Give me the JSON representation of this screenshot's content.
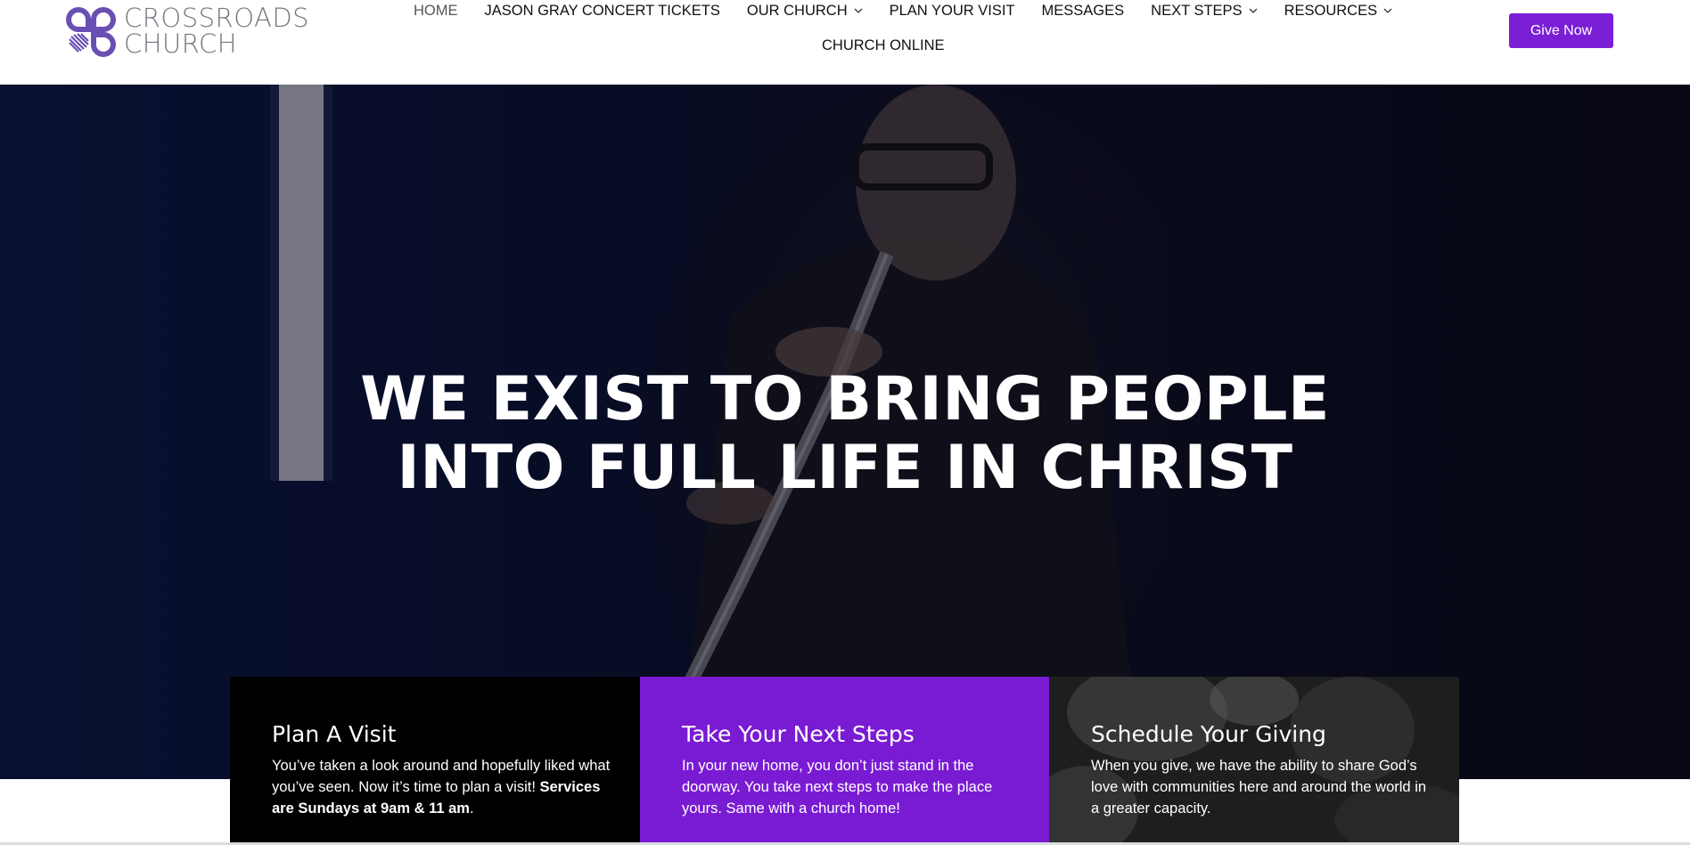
{
  "header": {
    "logo": {
      "line1": "CROSSROADS",
      "line2": "CHURCH"
    },
    "nav": [
      {
        "label": "HOME",
        "dropdown": false
      },
      {
        "label": "JASON GRAY CONCERT TICKETS",
        "dropdown": false
      },
      {
        "label": "OUR CHURCH",
        "dropdown": true
      },
      {
        "label": "PLAN YOUR VISIT",
        "dropdown": false
      },
      {
        "label": "MESSAGES",
        "dropdown": false
      },
      {
        "label": "NEXT STEPS",
        "dropdown": true
      },
      {
        "label": "RESOURCES",
        "dropdown": true
      }
    ],
    "nav_row2": "CHURCH ONLINE",
    "give_button": "Give Now"
  },
  "hero": {
    "line1": "WE EXIST TO BRING PEOPLE",
    "line2": "INTO FULL LIFE IN CHRIST"
  },
  "cards": [
    {
      "title": "Plan A Visit",
      "text": "You’ve taken a look around and hopefully liked what you’ve seen. Now it’s time to plan a visit! ",
      "bold": "Services are Sundays at 9am & 11 am",
      "tail": "."
    },
    {
      "title": "Take Your Next Steps",
      "text": "In your new home, you don’t just stand in the doorway. You take next steps to make the place yours. Same with a church home!"
    },
    {
      "title": "Schedule Your Giving",
      "text": "When you give, we have the ability to share God’s love with communities here and around the world in a greater capacity."
    }
  ],
  "colors": {
    "brand_purple": "#7a1fd6",
    "logo_purple": "#6a4fb3",
    "hero_dark": "#0a1235"
  },
  "icons": [
    "crossroads-logo-icon",
    "chevron-down-icon"
  ]
}
